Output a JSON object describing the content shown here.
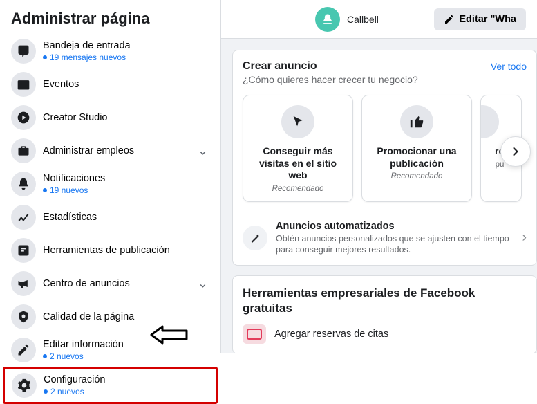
{
  "sidebar": {
    "title": "Administrar página",
    "items": [
      {
        "label": "Bandeja de entrada",
        "subtext": "19 mensajes nuevos"
      },
      {
        "label": "Eventos"
      },
      {
        "label": "Creator Studio"
      },
      {
        "label": "Administrar empleos"
      },
      {
        "label": "Notificaciones",
        "subtext": "19 nuevos"
      },
      {
        "label": "Estadísticas"
      },
      {
        "label": "Herramientas de publicación"
      },
      {
        "label": "Centro de anuncios"
      },
      {
        "label": "Calidad de la página"
      },
      {
        "label": "Editar información",
        "subtext": "2 nuevos"
      },
      {
        "label": "Configuración",
        "subtext": "2 nuevos"
      }
    ]
  },
  "header": {
    "page_name": "Callbell",
    "edit_button": "Editar \"Wha"
  },
  "create_ad": {
    "title": "Crear anuncio",
    "see_all": "Ver todo",
    "question": "¿Cómo quieres hacer crecer tu negocio?",
    "options": [
      {
        "title": "Conseguir más visitas en el sitio web",
        "sub": "Recomendado"
      },
      {
        "title": "Promocionar una publicación",
        "sub": "Recomendado"
      },
      {
        "title_partial": "ro",
        "sub_partial": "pu"
      }
    ],
    "auto": {
      "title": "Anuncios automatizados",
      "desc": "Obtén anuncios personalizados que se ajusten con el tiempo para conseguir mejores resultados."
    }
  },
  "tools": {
    "title": "Herramientas empresariales de Facebook gratuitas",
    "item": "Agregar reservas de citas"
  }
}
